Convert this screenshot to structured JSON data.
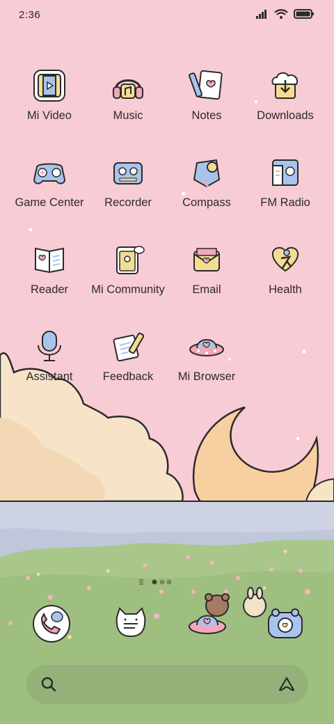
{
  "status": {
    "time": "2:36",
    "icons": [
      "signal-icon",
      "wifi-icon",
      "battery-icon"
    ]
  },
  "apps": [
    {
      "label": "Mi Video",
      "icon": "video-icon"
    },
    {
      "label": "Music",
      "icon": "headphones-icon"
    },
    {
      "label": "Notes",
      "icon": "notes-icon"
    },
    {
      "label": "Downloads",
      "icon": "download-icon"
    },
    {
      "label": "Game Center",
      "icon": "gamepad-icon"
    },
    {
      "label": "Recorder",
      "icon": "recorder-icon"
    },
    {
      "label": "Compass",
      "icon": "compass-icon"
    },
    {
      "label": "FM Radio",
      "icon": "radio-icon"
    },
    {
      "label": "Reader",
      "icon": "book-icon"
    },
    {
      "label": "Mi Community",
      "icon": "community-icon"
    },
    {
      "label": "Email",
      "icon": "email-icon"
    },
    {
      "label": "Health",
      "icon": "health-icon"
    },
    {
      "label": "Assistant",
      "icon": "microphone-icon"
    },
    {
      "label": "Feedback",
      "icon": "feedback-icon"
    },
    {
      "label": "Mi Browser",
      "icon": "browser-icon"
    }
  ],
  "dock": [
    {
      "icon": "phone-icon"
    },
    {
      "icon": "messages-icon"
    },
    {
      "icon": "browser-icon"
    },
    {
      "icon": "camera-icon"
    }
  ],
  "page_indicator": {
    "pages": 2,
    "current": 1
  },
  "colors": {
    "sky": "#f8ccd4",
    "cloud": "#f7e3c8",
    "moon": "#f7cfa0",
    "water": "#cdd3e3",
    "grass": "#a9c78b",
    "icon_blue": "#a9c4ec",
    "icon_yellow": "#f5dc93",
    "icon_pink": "#f3a7b8"
  }
}
